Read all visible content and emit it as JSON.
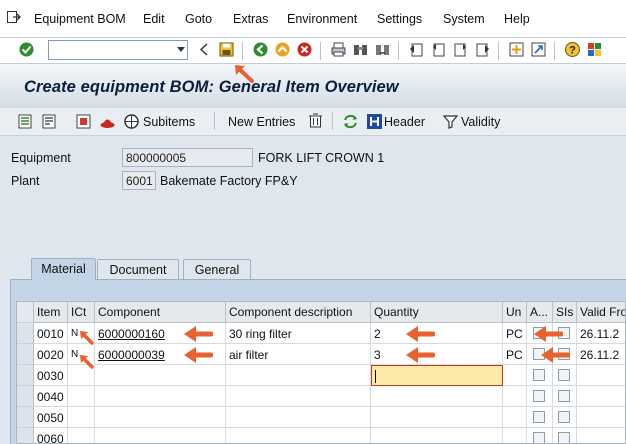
{
  "menu": {
    "items": [
      "Equipment BOM",
      "Edit",
      "Goto",
      "Extras",
      "Environment",
      "Settings",
      "System",
      "Help"
    ]
  },
  "toolbar": {
    "command_value": ""
  },
  "title": "Create equipment BOM: General Item Overview",
  "app_toolbar": {
    "subitems": "Subitems",
    "new_entries": "New Entries",
    "header": "Header",
    "validity": "Validity"
  },
  "header": {
    "equipment_label": "Equipment",
    "equipment_value": "800000005",
    "equipment_desc": "FORK LIFT CROWN 1",
    "plant_label": "Plant",
    "plant_value": "6001",
    "plant_desc": "Bakemate Factory FP&Y"
  },
  "tabs": [
    "Material",
    "Document",
    "General"
  ],
  "table": {
    "columns": [
      "Item",
      "ICt",
      "Component",
      "Component description",
      "Quantity",
      "Un",
      "A...",
      "SIs",
      "Valid Fro"
    ],
    "rows": [
      {
        "item": "0010",
        "ict": "N",
        "component": "6000000160",
        "desc": "30 ring filter",
        "qty": "2",
        "un": "PC",
        "valid": "26.11.2"
      },
      {
        "item": "0020",
        "ict": "N",
        "component": "6000000039",
        "desc": "air filter",
        "qty": "3",
        "un": "PC",
        "valid": "26.11.2"
      },
      {
        "item": "0030",
        "ict": "",
        "component": "",
        "desc": "",
        "qty": "",
        "un": "",
        "valid": ""
      },
      {
        "item": "0040",
        "ict": "",
        "component": "",
        "desc": "",
        "qty": "",
        "un": "",
        "valid": ""
      },
      {
        "item": "0050",
        "ict": "",
        "component": "",
        "desc": "",
        "qty": "",
        "un": "",
        "valid": ""
      },
      {
        "item": "0060",
        "ict": "",
        "component": "",
        "desc": "",
        "qty": "",
        "un": "",
        "valid": ""
      }
    ]
  },
  "colors": {
    "annotation_arrow": "#e8622f",
    "focus_cell": "#fbe9a7"
  }
}
